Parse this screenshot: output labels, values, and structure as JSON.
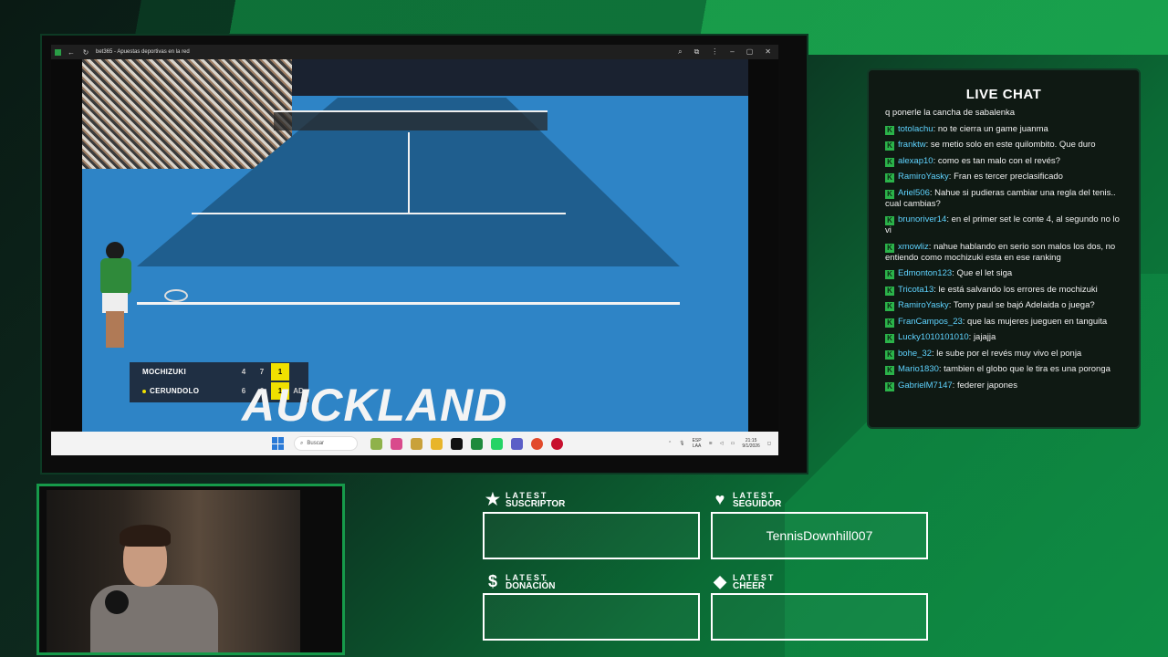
{
  "browser": {
    "tab_title": "bet365 - Apuestas deportivas en la red",
    "taskbar": {
      "search_placeholder": "Buscar",
      "lang": "ESP",
      "lang_sub": "LAA",
      "time": "21:15",
      "date": "9/1/2026"
    }
  },
  "match": {
    "players": [
      {
        "name": "MOCHIZUKI",
        "set1": "4",
        "set2": "7",
        "current": "1",
        "points": ""
      },
      {
        "name": "CERUNDOLO",
        "set1": "6",
        "set2": "6",
        "current": "1",
        "points": "AD"
      }
    ],
    "city": "AUCKLAND"
  },
  "chat": {
    "title": "LIVE CHAT",
    "first_line": "q ponerle la cancha de sabalenka",
    "messages": [
      {
        "user": "totolachu",
        "text": "no te cierra un game juanma"
      },
      {
        "user": "franktw",
        "text": "se metio solo en este quilombito. Que duro"
      },
      {
        "user": "alexap10",
        "text": "como es tan malo con el revés?"
      },
      {
        "user": "RamiroYasky",
        "text": "Fran es tercer preclasificado"
      },
      {
        "user": "Ariel506",
        "text": "Nahue si pudieras cambiar una regla del tenis.. cual cambias?"
      },
      {
        "user": "brunoriver14",
        "text": "en el primer set le conte 4, al segundo no lo vi"
      },
      {
        "user": "xmowliz",
        "text": "nahue hablando en serio son malos los dos, no entiendo como mochizuki esta en ese ranking"
      },
      {
        "user": "Edmonton123",
        "text": "Que el let siga"
      },
      {
        "user": "Tricota13",
        "text": "le está salvando los errores de mochizuki"
      },
      {
        "user": "RamiroYasky",
        "text": "Tomy paul se bajó Adelaida o juega?"
      },
      {
        "user": "FranCampos_23",
        "text": "que las mujeres jueguen en tanguita"
      },
      {
        "user": "Lucky1010101010",
        "text": "jajajja"
      },
      {
        "user": "bohe_32",
        "text": "le sube por el revés muy vivo el ponja"
      },
      {
        "user": "Mario1830",
        "text": "tambien el globo que le tira es una poronga"
      },
      {
        "user": "GabrielM7147",
        "text": "federer japones"
      }
    ]
  },
  "alerts": {
    "latest": "LATEST",
    "suscriptor": {
      "label": "SUSCRIPTOR",
      "value": "",
      "icon": "star-icon"
    },
    "seguidor": {
      "label": "SEGUIDOR",
      "value": "TennisDownhill007",
      "icon": "heart-icon"
    },
    "donacion": {
      "label": "DONACIÓN",
      "value": "",
      "icon": "dollar-icon"
    },
    "cheer": {
      "label": "CHEER",
      "value": "",
      "icon": "diamond-icon"
    }
  }
}
